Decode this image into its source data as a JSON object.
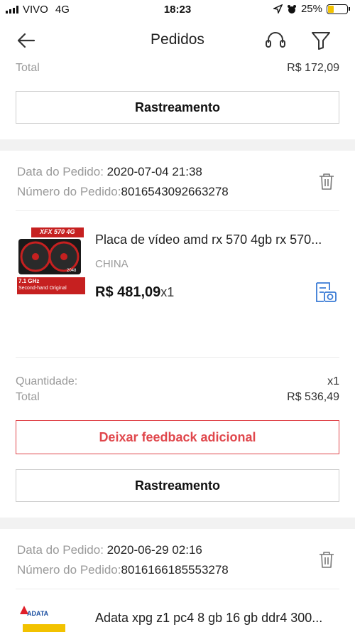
{
  "status_bar": {
    "carrier": "VIVO",
    "network": "4G",
    "time": "18:23",
    "battery": "25%"
  },
  "nav": {
    "title": "Pedidos",
    "back_icon": "arrow-left-icon",
    "support_icon": "headset-icon",
    "filter_icon": "filter-icon"
  },
  "top_card": {
    "total_label": "Total",
    "total_value": "R$ 172,09",
    "tracking_button": "Rastreamento"
  },
  "order1": {
    "date_label": "Data do Pedido:",
    "date_value": "2020-07-04 21:38",
    "number_label": "Número do Pedido:",
    "number_value": "8016543092663278",
    "product": {
      "title": "Placa de vídeo amd rx 570 4gb rx 570...",
      "origin": "CHINA",
      "price": "R$ 481,09",
      "qty": "x1",
      "thumb_text": {
        "model": "XFX 570 4G",
        "speed": "7.1 GHz",
        "note": "Second-hand Original",
        "badge": "2048"
      }
    },
    "quantity_label": "Quantidade:",
    "quantity_value": "x1",
    "total_label": "Total",
    "total_value": "R$ 536,49",
    "feedback_button": "Deixar feedback adicional",
    "tracking_button": "Rastreamento"
  },
  "order2": {
    "date_label": "Data do Pedido:",
    "date_value": "2020-06-29 02:16",
    "number_label": "Número do Pedido:",
    "number_value": "8016166185553278",
    "product": {
      "title": "Adata xpg z1 pc4 8 gb 16 gb ddr4 300...",
      "brand_logo": "ADATA"
    }
  },
  "colors": {
    "accent": "#e0474c",
    "muted": "#9a9a9a",
    "icon_blue": "#3a7bd5"
  }
}
